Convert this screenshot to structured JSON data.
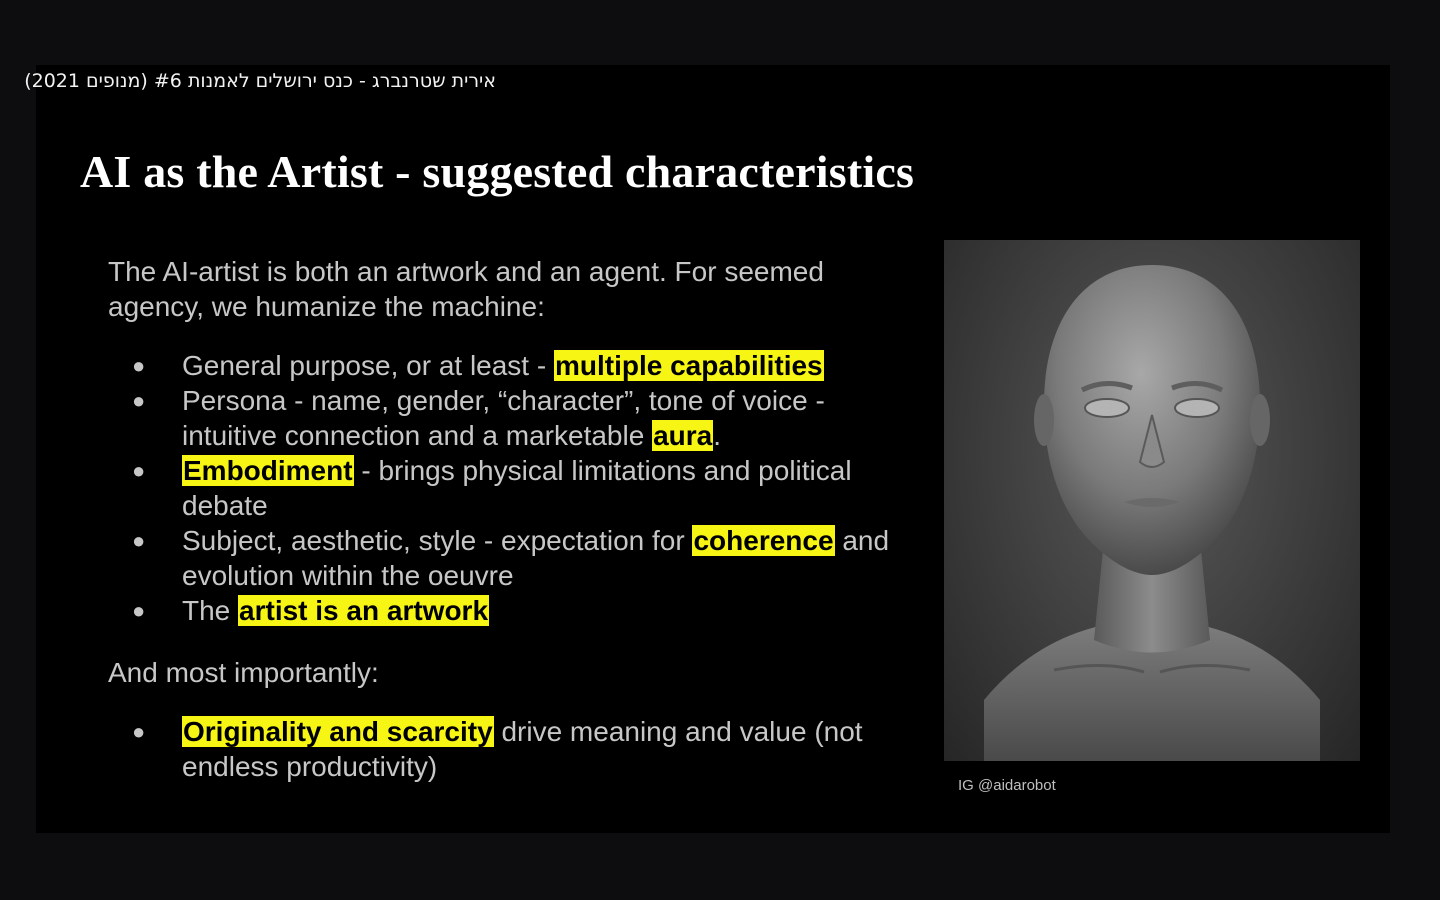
{
  "video": {
    "title": "אירית שטרנברג - כנס ירושלים לאמנות #6 (מנופים 2021)"
  },
  "slide": {
    "title": "AI as the Artist - suggested characteristics",
    "intro": "The AI-artist is both an artwork and an agent. For seemed agency, we humanize the machine:",
    "bullet_char": "●",
    "items": [
      {
        "pre": "General purpose, or at least - ",
        "hl": "multiple capabilities",
        "post": ""
      },
      {
        "pre": "Persona - name, gender, “character”, tone of voice - intuitive connection and a marketable ",
        "hl": "aura",
        "post": "."
      },
      {
        "pre": "",
        "hl": "Embodiment",
        "post": " - brings physical limitations and political debate"
      },
      {
        "pre": "Subject, aesthetic, style  - expectation for ",
        "hl": "coherence",
        "post": " and evolution within the oeuvre"
      },
      {
        "pre": "The ",
        "hl": "artist is an artwork",
        "post": ""
      }
    ],
    "more_label": "And most importantly:",
    "final_item": {
      "pre": "",
      "hl": "Originality and scarcity",
      "post": " drive meaning and value (not endless productivity)"
    },
    "image_credit": "IG @aidarobot",
    "image_icon": "sculpted-head-bust",
    "highlight_color": "#f7f514"
  }
}
